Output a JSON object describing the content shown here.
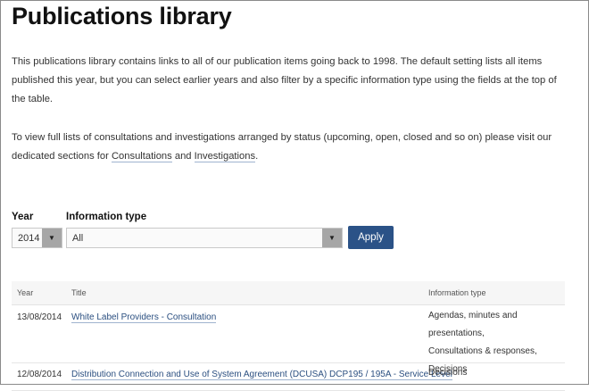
{
  "page": {
    "title": "Publications library",
    "intro1": "This publications library contains links to all of our publication items going back to 1998. The default setting lists all items published this year, but you can select earlier years and also filter by a specific information type using the fields at the top of the table.",
    "intro2_before": "To view full lists of consultations and investigations arranged by status (upcoming, open, closed and so on) please visit our dedicated sections for ",
    "link_consultations": "Consultations",
    "intro2_and": " and ",
    "link_investigations": "Investigations",
    "intro2_after": "."
  },
  "filters": {
    "year_label": "Year",
    "year_value": "2014",
    "type_label": "Information type",
    "type_value": "All",
    "apply_label": "Apply"
  },
  "table": {
    "headers": {
      "year": "Year",
      "title": "Title",
      "type": "Information type"
    },
    "rows": [
      {
        "year": "13/08/2014",
        "title": "White Label Providers - Consultation",
        "types": [
          "Agendas, minutes and presentations,",
          "Consultations & responses,",
          "Decisions"
        ]
      },
      {
        "year": "12/08/2014",
        "title": "Distribution Connection and Use of System Agreement (DCUSA) DCP195 / 195A - Service Level",
        "types": [
          "Decisions"
        ]
      }
    ]
  }
}
